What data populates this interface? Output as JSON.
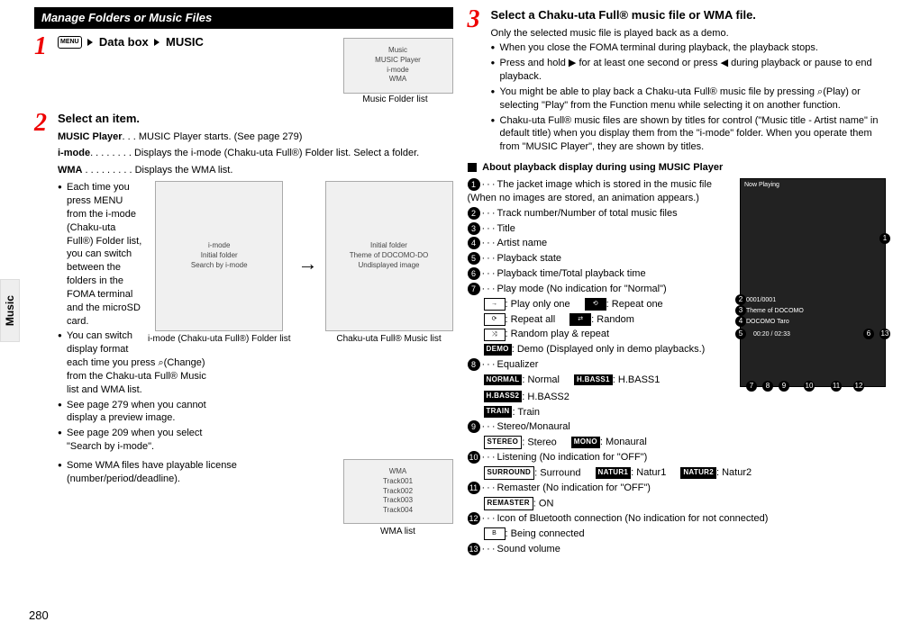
{
  "sideTab": "Music",
  "pageNumber": "280",
  "left": {
    "headingBar": "Manage Folders or Music Files",
    "step1": {
      "num": "1",
      "menuBadge": "MENU",
      "part1": "Data box",
      "part2": "MUSIC",
      "shotCaption": "Music Folder list",
      "shotLines": "Music\nMUSIC Player\ni-mode\nWMA"
    },
    "step2": {
      "num": "2",
      "title": "Select an item.",
      "lineA_b": "MUSIC Player",
      "lineA_rest": ". . . MUSIC Player starts. (See page 279)",
      "lineB_b": "i-mode",
      "lineB_rest": ". . . . . . . . Displays the i-mode (Chaku-uta Full®) Folder list. Select a folder.",
      "lineC_b": "WMA",
      "lineC_rest": " . . . . . . . . . Displays the WMA list.",
      "bullets": [
        "Each time you press MENU from the i-mode (Chaku-uta Full®) Folder list, you can switch between the folders in the FOMA terminal and the microSD card.",
        "You can switch display format each time you press ⌕(Change) from the Chaku-uta Full® Music list and WMA list.",
        "See page 279 when you cannot display a preview image.",
        "See page 209 when you select \"Search by i-mode\".",
        "Some WMA files have playable license (number/period/deadline)."
      ],
      "shotImodeCaption": "i-mode (Chaku-uta Full®) Folder list",
      "shotChakuCaption": "Chaku-uta Full® Music list",
      "shotWmaCaption": "WMA list",
      "arrow": "→",
      "softChange": "Change",
      "shotImodeLines": "i-mode\nInitial folder\nSearch by i-mode",
      "shotChakuLines": "Initial folder\nTheme of DOCOMO-DO\nUndisplayed image",
      "shotWmaLines": "WMA\nTrack001\nTrack002\nTrack003\nTrack004"
    }
  },
  "right": {
    "step3": {
      "num": "3",
      "title": "Select a Chaku-uta Full® music file or WMA file.",
      "intro": "Only the selected music file is played back as a demo.",
      "bullets": [
        "When you close the FOMA terminal during playback, the playback stops.",
        "Press and hold ▶ for at least one second or press ◀ during playback or pause to end playback.",
        "You might be able to play back a Chaku-uta Full® music file by pressing ⌕(Play) or selecting \"Play\" from the Function menu while selecting it on another function.",
        "Chaku-uta Full® music files are shown by titles for control (\"Music title - Artist name\" in default title) when you display them from the \"i-mode\" folder. When you operate them from \"MUSIC Player\", they are shown by titles."
      ],
      "softPlay": "Play"
    },
    "about": {
      "heading": "About playback display during using MUSIC Player",
      "items": [
        "The jacket image which is stored in the music file (When no images are stored, an animation appears.)",
        "Track number/Number of total music files",
        "Title",
        "Artist name",
        "Playback state",
        "Playback time/Total playback time",
        "Play mode (No indication for \"Normal\")",
        "Equalizer",
        "Stereo/Monaural",
        "Listening (No indication for \"OFF\")",
        "Remaster (No indication for \"OFF\")",
        "Icon of Bluetooth connection (No indication for not connected)",
        "Sound volume"
      ],
      "playModes": {
        "one": "Play only one",
        "repOne": "Repeat one",
        "repAll": "Repeat all",
        "random": "Random",
        "randRep": "Random play & repeat",
        "demoLabel": "DEMO",
        "demo": "Demo (Displayed only in demo playbacks.)"
      },
      "eq": {
        "normalLabel": "NORMAL",
        "normal": "Normal",
        "hb1Label": "H.BASS1",
        "hb1": "H.BASS1",
        "hb2Label": "H.BASS2",
        "hb2": "H.BASS2",
        "trainLabel": "TRAIN",
        "train": "Train"
      },
      "stereo": {
        "stLabel": "STEREO",
        "st": "Stereo",
        "moLabel": "MONO",
        "mo": "Monaural"
      },
      "listening": {
        "surLabel": "SURROUND",
        "sur": "Surround",
        "n1Label": "NATUR1",
        "n1": "Natur1",
        "n2Label": "NATUR2",
        "n2": "Natur2"
      },
      "remaster": {
        "onLabel": "REMASTER",
        "on": "ON"
      },
      "bt": {
        "conn": "Being connected"
      },
      "playerShot": {
        "nowPlaying": "Now Playing",
        "track": "0001/0001",
        "title": "Theme of DOCOMO",
        "artist": "DOCOMO Taro",
        "time": "00:20 / 02:33"
      }
    }
  }
}
